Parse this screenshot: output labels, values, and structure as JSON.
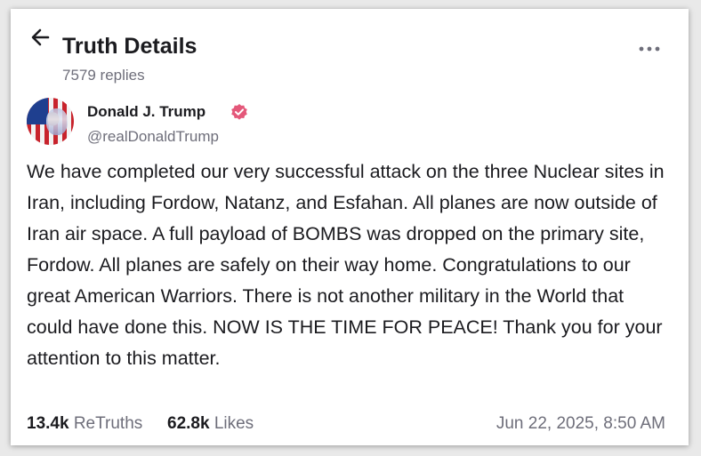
{
  "header": {
    "title": "Truth Details",
    "replies": "7579 replies",
    "back_icon": "arrow-left-icon",
    "more_icon": "more-horizontal-icon"
  },
  "post": {
    "author": {
      "name": "Donald J. Trump",
      "handle": "@realDonaldTrump",
      "verified_icon": "verified-badge-icon",
      "verified_color": "#e4587a"
    },
    "text": "We have completed our very successful attack on the three Nuclear sites in Iran, including Fordow, Natanz, and Esfahan. All planes are now outside of Iran air space. A full payload of BOMBS was dropped on the primary site, Fordow. All planes are safely on their way home. Congratulations to our great American Warriors. There is not another military in the World that could have done this. NOW IS THE TIME FOR PEACE! Thank you for your attention to this matter.",
    "stats": {
      "retruths_count": "13.4k",
      "retruths_label": "ReTruths",
      "likes_count": "62.8k",
      "likes_label": "Likes"
    },
    "timestamp": "Jun 22, 2025, 8:50 AM"
  },
  "colors": {
    "text": "#1b1b1f",
    "muted": "#6e6e7a",
    "background": "#ffffff"
  }
}
